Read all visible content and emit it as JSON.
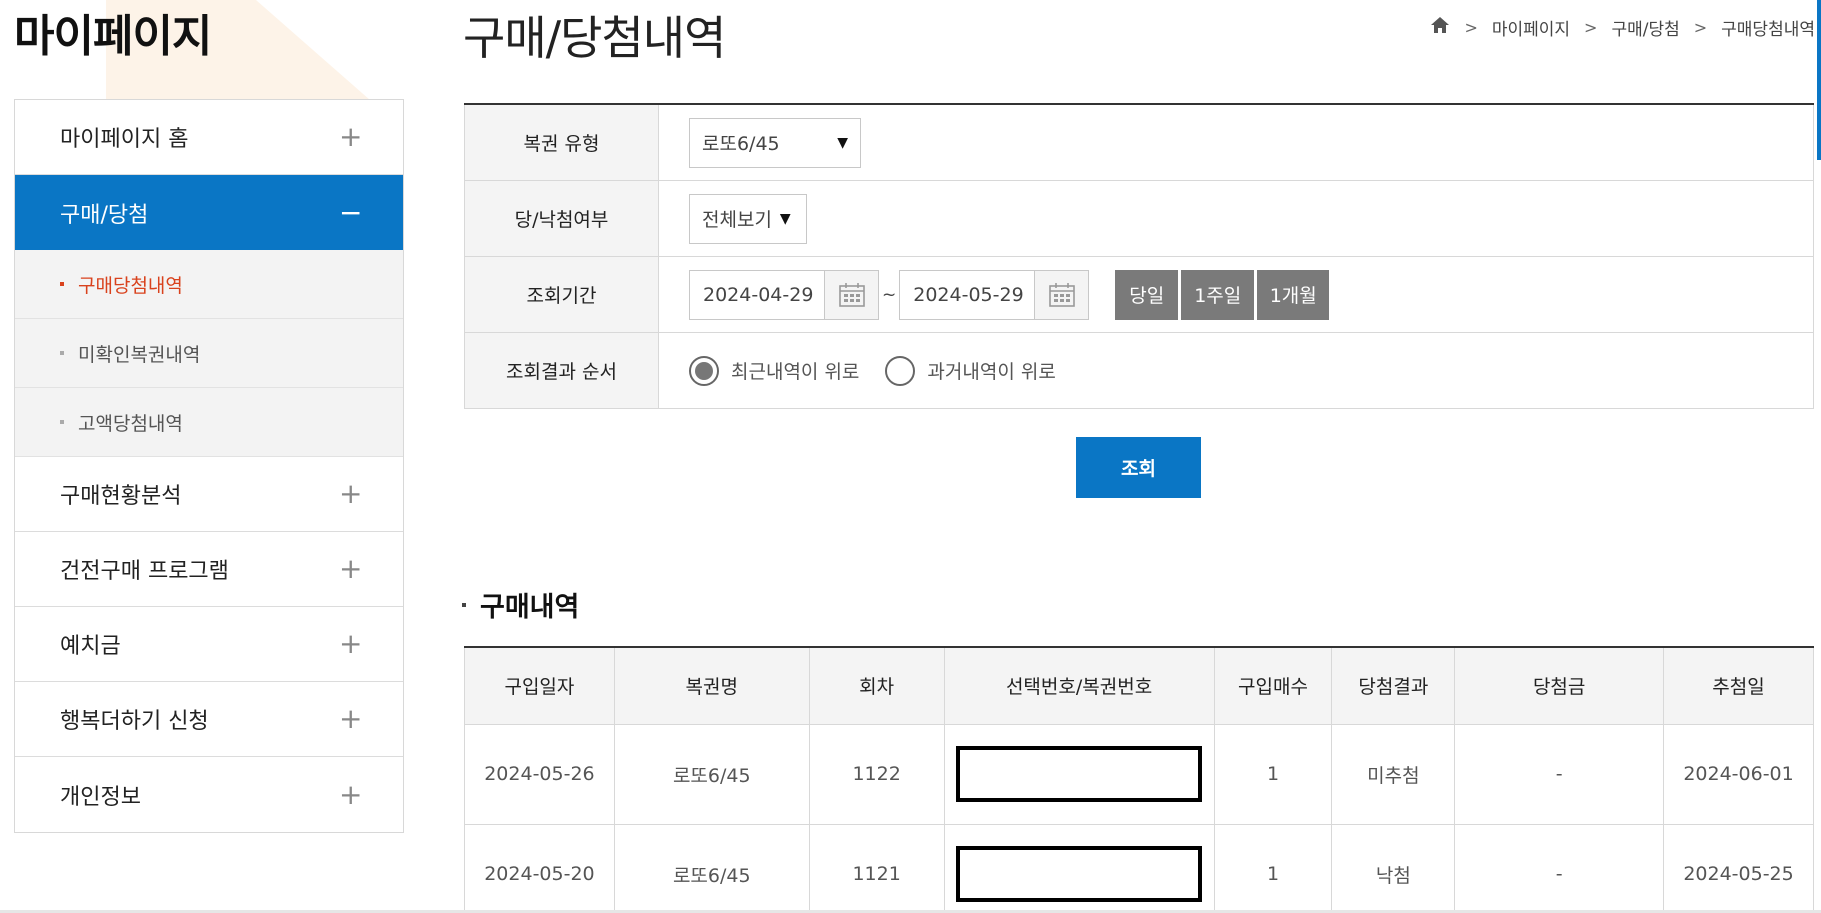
{
  "sidebar": {
    "title": "마이페이지",
    "menu": [
      {
        "label": "마이페이지 홈",
        "sign": "+"
      },
      {
        "label": "구매/당첨",
        "sign": "−"
      },
      {
        "label": "구매현황분석",
        "sign": "+"
      },
      {
        "label": "건전구매 프로그램",
        "sign": "+"
      },
      {
        "label": "예치금",
        "sign": "+"
      },
      {
        "label": "행복더하기 신청",
        "sign": "+"
      },
      {
        "label": "개인정보",
        "sign": "+"
      }
    ],
    "submenu": [
      {
        "label": "구매당첨내역"
      },
      {
        "label": "미확인복권내역"
      },
      {
        "label": "고액당첨내역"
      }
    ]
  },
  "page": {
    "title": "구매/당첨내역"
  },
  "breadcrumb": {
    "items": [
      "마이페이지",
      "구매/당첨",
      "구매당첨내역"
    ]
  },
  "form": {
    "lottery_type_label": "복권 유형",
    "lottery_type_value": "로또6/45",
    "win_status_label": "당/낙첨여부",
    "win_status_value": "전체보기",
    "period_label": "조회기간",
    "start_date": "2024-04-29",
    "tilde": "~",
    "end_date": "2024-05-29",
    "period_buttons": [
      "당일",
      "1주일",
      "1개월"
    ],
    "order_label": "조회결과 순서",
    "order_options": [
      "최근내역이 위로",
      "과거내역이 위로"
    ],
    "order_selected": "최근내역이 위로",
    "search_button": "조회"
  },
  "purchase": {
    "section_title": "구매내역",
    "columns": [
      "구입일자",
      "복권명",
      "회차",
      "선택번호/복권번호",
      "구입매수",
      "당첨결과",
      "당첨금",
      "추첨일"
    ],
    "rows": [
      {
        "date": "2024-05-26",
        "name": "로또6/45",
        "round": "1122",
        "count": "1",
        "result": "미추첨",
        "prize": "-",
        "draw_date": "2024-06-01"
      },
      {
        "date": "2024-05-20",
        "name": "로또6/45",
        "round": "1121",
        "count": "1",
        "result": "낙첨",
        "prize": "-",
        "draw_date": "2024-05-25"
      }
    ]
  },
  "colors": {
    "accent": "#0a76c5",
    "current_sub": "#d9421d",
    "period_button": "#7a7a7a"
  },
  "icons": {
    "home": "home-icon",
    "calendar": "calendar-icon",
    "caret": "caret-down-icon"
  }
}
